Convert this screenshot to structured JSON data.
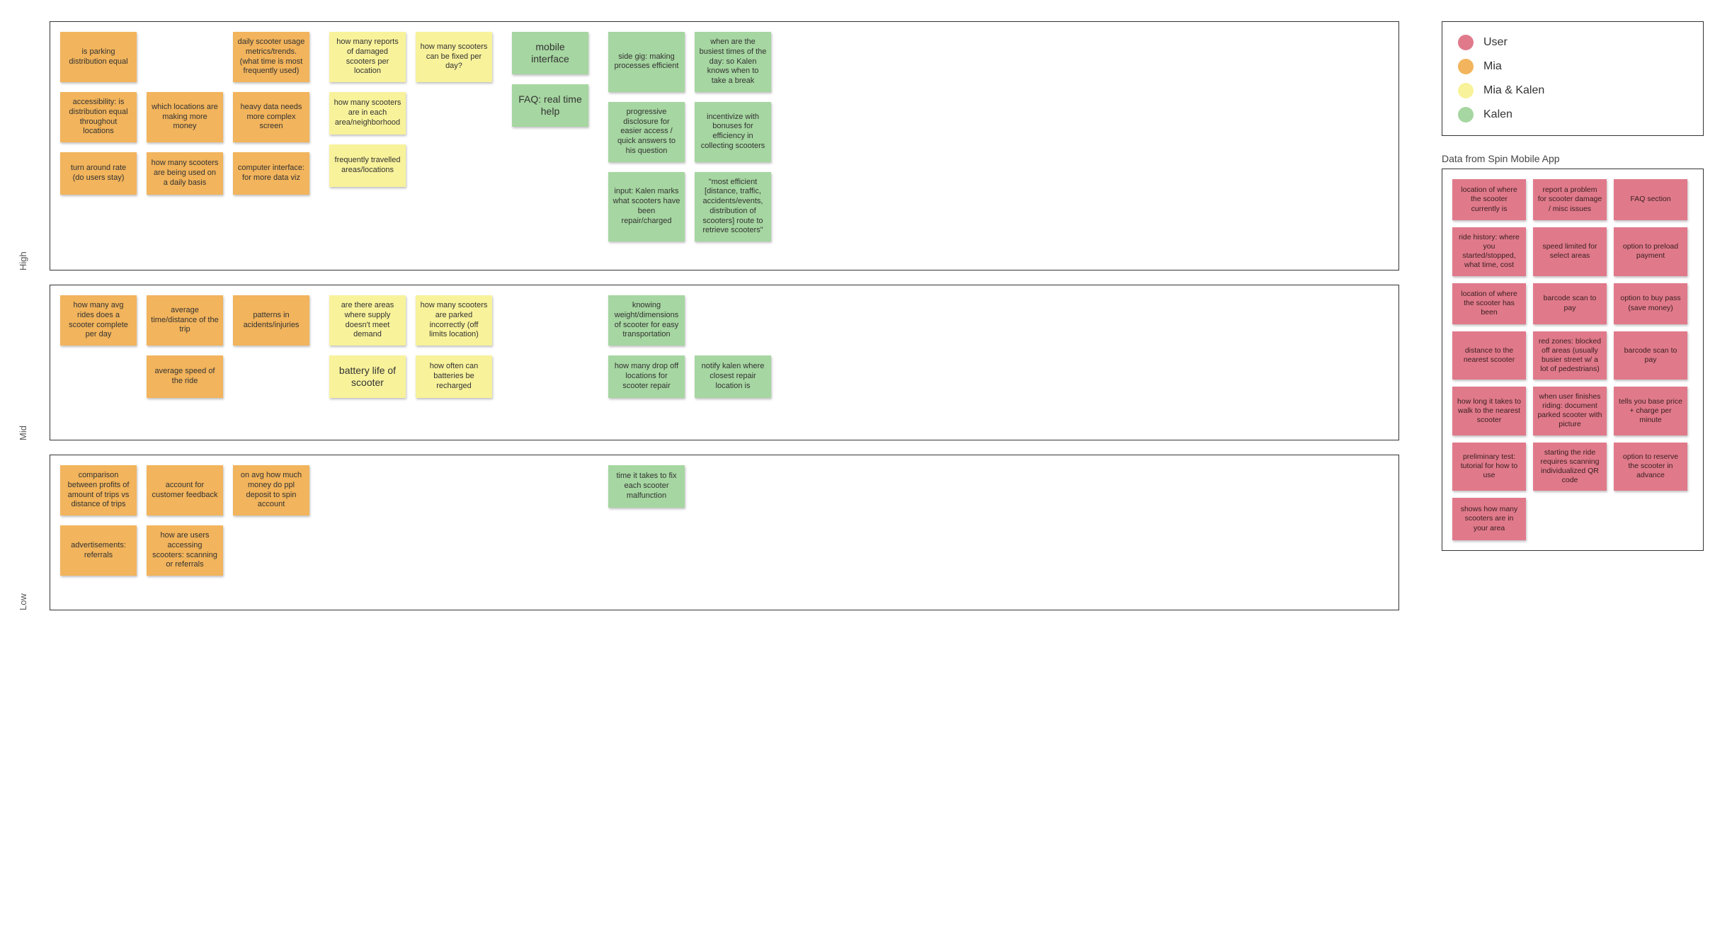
{
  "legend": {
    "user": "User",
    "mia": "Mia",
    "both": "Mia & Kalen",
    "kalen": "Kalen"
  },
  "priority_labels": {
    "high": "High",
    "mid": "Mid",
    "low": "Low"
  },
  "side_panel_title": "Data from Spin Mobile App",
  "high": {
    "mia": [
      [
        "is parking distribution equal",
        "",
        "daily scooter usage metrics/trends. (what time is most frequently used)"
      ],
      [
        "accessibility: is distribution equal throughout locations",
        "which locations are making more money",
        "heavy data needs more complex screen"
      ],
      [
        "turn around rate (do users stay)",
        "how many scooters are being used on a daily basis",
        "computer interface: for more data viz"
      ]
    ],
    "both": [
      [
        "how many reports of damaged scooters per location",
        "how many scooters can be fixed per day?"
      ],
      [
        "how many scooters are in each area/neighborhood",
        ""
      ],
      [
        "frequently travelled areas/locations",
        ""
      ]
    ],
    "kalen_left": [
      "mobile interface",
      "FAQ: real time help"
    ],
    "kalen": [
      [
        "side gig: making processes efficient",
        "when are the busiest times of the day: so Kalen knows when to take a break"
      ],
      [
        "progressive disclosure for easier access / quick answers to his question",
        "incentivize with bonuses for efficiency in collecting scooters"
      ],
      [
        "input: Kalen marks what scooters have been repair/charged",
        "\"most efficient [distance, traffic, accidents/events, distribution of scooters] route to retrieve scooters\""
      ]
    ]
  },
  "mid": {
    "mia": [
      [
        "how many avg rides does a scooter complete per day",
        "average time/distance of the trip",
        "patterns in acidents/injuries"
      ],
      [
        "",
        "average speed of the ride",
        ""
      ]
    ],
    "both": [
      [
        "are there areas where supply doesn't meet demand",
        "how many scooters are parked incorrectly (off limits location)"
      ],
      [
        "battery life of scooter",
        "how often can batteries be recharged"
      ]
    ],
    "kalen": [
      [
        "knowing weight/dimensions of scooter for easy transportation",
        ""
      ],
      [
        "how many drop off locations for scooter repair",
        "notify kalen where closest repair location is"
      ]
    ]
  },
  "low": {
    "mia": [
      [
        "comparison between profits of amount of trips vs distance of trips",
        "account for customer feedback",
        "on avg how much money do ppl deposit to spin account"
      ],
      [
        "advertisements: referrals",
        "how are users accessing scooters: scanning or referrals",
        ""
      ]
    ],
    "kalen_single": "time it takes to fix each scooter malfunction"
  },
  "user_data": [
    [
      "location of where the scooter currently is",
      "report a problem for scooter damage / misc issues",
      "FAQ section"
    ],
    [
      "ride history: where you started/stopped, what time, cost",
      "speed limited for select areas",
      "option to preload payment"
    ],
    [
      "location of where the scooter has been",
      "barcode scan to pay",
      "option to buy pass (save money)"
    ],
    [
      "distance to the nearest scooter",
      "red zones: blocked off areas (usually busier street w/ a lot of pedestrians)",
      "barcode scan to pay"
    ],
    [
      "how long it takes to walk to the nearest scooter",
      "when user finishes riding: document parked scooter with picture",
      "tells you base price + charge per minute"
    ],
    [
      "preliminary test: tutorial for how to use",
      "starting the ride requires scanning individualized QR code",
      "option to reserve the scooter in advance"
    ],
    [
      "shows how many scooters are in your area",
      "",
      ""
    ]
  ]
}
